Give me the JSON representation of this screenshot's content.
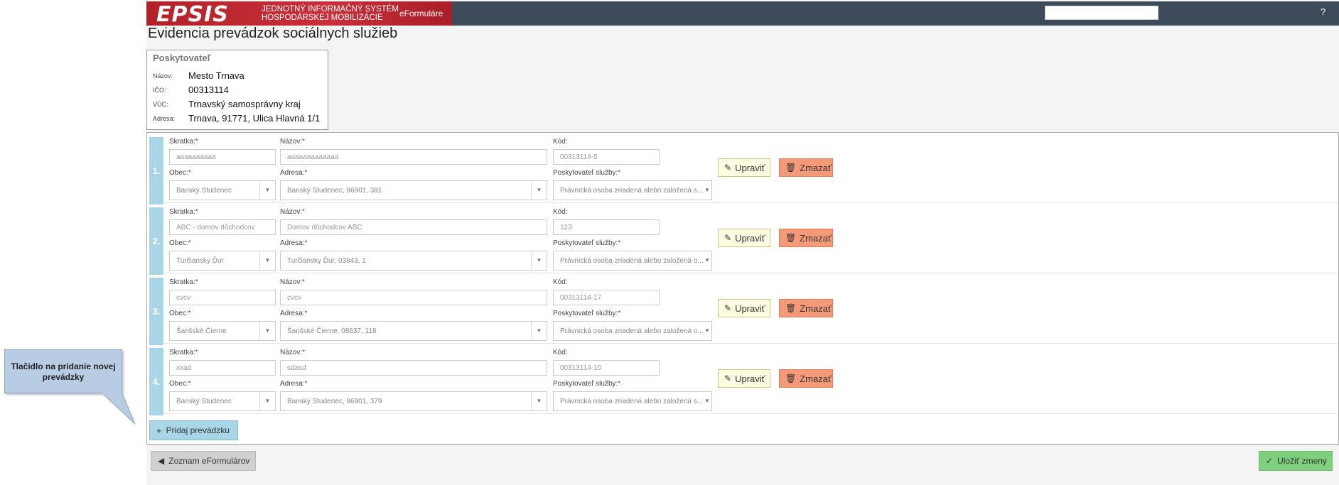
{
  "header": {
    "logo": "EPSIS",
    "system_line1": "JEDNOTNÝ INFORMAČNÝ SYSTÉM",
    "system_line2": "HOSPODÁRSKEJ MOBILIZÁCIE",
    "module": "eFormuláre",
    "help": "?"
  },
  "page_title": "Evidencia prevádzok sociálnych služieb",
  "provider": {
    "heading": "Poskytovateľ",
    "rows": [
      {
        "key": "Názov:",
        "value": "Mesto Trnava"
      },
      {
        "key": "IČO:",
        "value": "00313114"
      },
      {
        "key": "VÚC:",
        "value": "Trnavský samosprávny kraj"
      },
      {
        "key": "Adresa:",
        "value": "Trnava, 91771, Ulica Hlavná 1/1"
      }
    ]
  },
  "labels": {
    "skratka": "Skratka:",
    "nazov": "Názov:",
    "kod": "Kód:",
    "obec": "Obec:",
    "adresa": "Adresa:",
    "poskytovatel": "Poskytovateľ služby:",
    "required": "*",
    "edit": "Upraviť",
    "delete": "Zmazať"
  },
  "items": [
    {
      "num": "1.",
      "skratka": "aaaaaaaaaa",
      "nazov": "aaaaaaaaaaaaa",
      "kod": "00313114-5",
      "obec": "Banský Studenec",
      "adresa": "Banský Studenec, 96901, 381",
      "poskytovatel": "Právnická osoba zriadená alebo založená s..."
    },
    {
      "num": "2.",
      "skratka": "ABC - domov dôchodcov",
      "nazov": "Domov dôchodcov ABC",
      "kod": "123",
      "obec": "Turčiansky Ďur",
      "adresa": "Turčiansky Ďur, 03843, 1",
      "poskytovatel": "Právnická osoba zriadená alebo založená o..."
    },
    {
      "num": "3.",
      "skratka": "cvcv",
      "nazov": "cvcv",
      "kod": "00313114-17",
      "obec": "Šarišské Čierne",
      "adresa": "Šarišské Čierne, 08637, 118",
      "poskytovatel": "Právnická osoba zriadená alebo založená o..."
    },
    {
      "num": "4.",
      "skratka": "xxad",
      "nazov": "sdasd",
      "kod": "00313114-10",
      "obec": "Banský Studenec",
      "adresa": "Banský Studenec, 96901, 379",
      "poskytovatel": "Právnická osoba zriadená alebo založená s..."
    }
  ],
  "add_button": "Pridaj prevádzku",
  "back_button": "Zoznam eFormulárov",
  "save_button": "Uložiť zmeny",
  "callout": "Tlačidlo na pridanie novej prevádzky"
}
